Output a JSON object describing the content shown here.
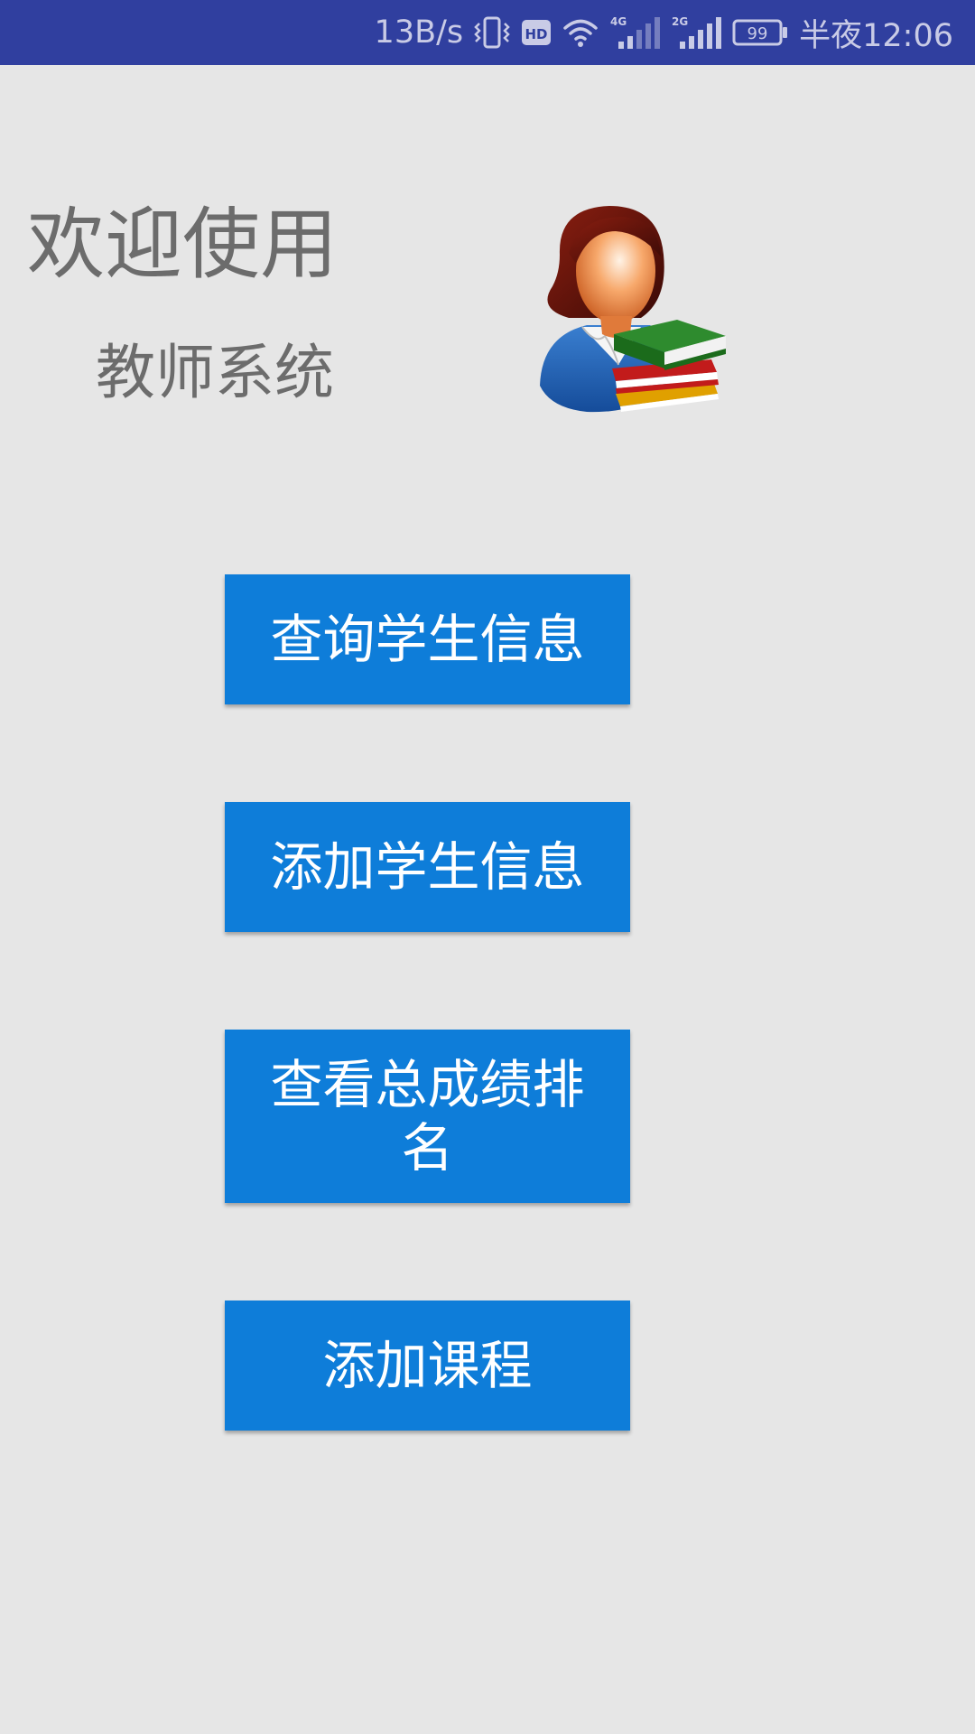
{
  "status_bar": {
    "net_speed": "13B/s",
    "icons": [
      "vibrate-icon",
      "hd-icon",
      "wifi-icon",
      "signal-4g-icon",
      "signal-2g-icon",
      "battery-icon"
    ],
    "hd_label": "HD",
    "network_4g_label": "4G",
    "network_2g_label": "2G",
    "battery_level": "99",
    "time": "半夜12:06"
  },
  "header": {
    "welcome": "欢迎使用",
    "system_name": "教师系统",
    "avatar_icon": "teacher-with-books-icon"
  },
  "menu": {
    "buttons": [
      {
        "label": "查询学生信息"
      },
      {
        "label": "添加学生信息"
      },
      {
        "label": "查看总成绩排名"
      },
      {
        "label": "添加课程"
      }
    ]
  },
  "colors": {
    "status_bar": "#303f9f",
    "background": "#e6e6e6",
    "button": "#0e7dd9",
    "button_text": "#ffffff",
    "heading_text": "#6c6c6c"
  }
}
